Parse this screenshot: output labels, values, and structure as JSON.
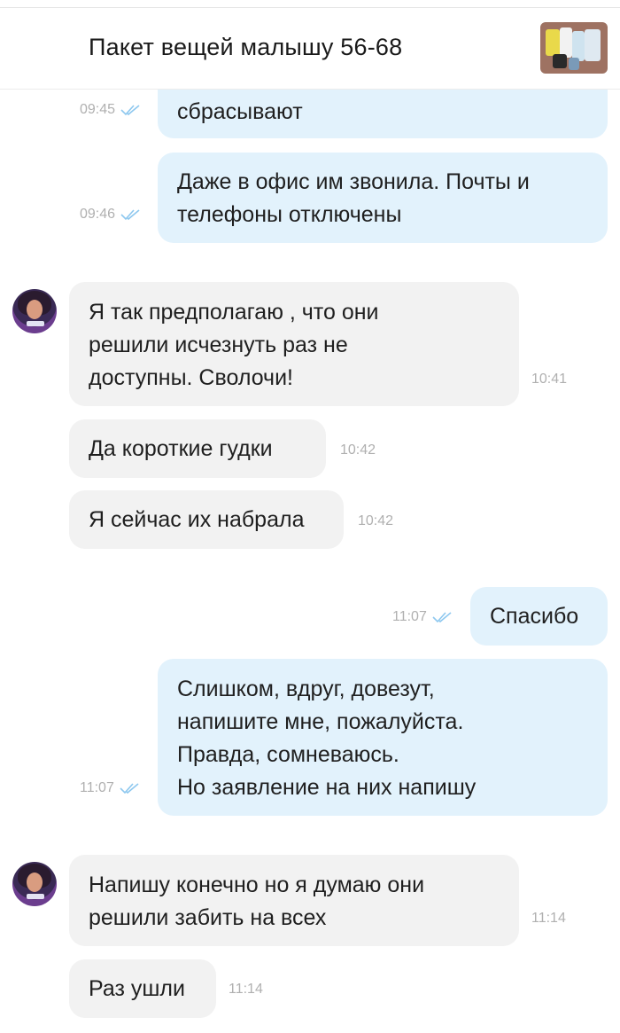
{
  "header": {
    "title": "Пакет вещей малышу 56-68",
    "thumbnail_icon": "product-photo"
  },
  "messages": [
    {
      "dir": "out",
      "text": "сбрасывают",
      "time": "09:45",
      "status": "read"
    },
    {
      "dir": "out",
      "text": "Даже в офис им звонила. Почты и\nтелефоны отключены",
      "time": "09:46",
      "status": "read"
    },
    {
      "dir": "in",
      "text": "Я так предполагаю , что они\nрешили исчезнуть раз не\nдоступны. Сволочи!",
      "time": "10:41"
    },
    {
      "dir": "in",
      "text": "Да короткие гудки",
      "time": "10:42"
    },
    {
      "dir": "in",
      "text": "Я сейчас их набрала",
      "time": "10:42"
    },
    {
      "dir": "out",
      "text": "Спасибо",
      "time": "11:07",
      "status": "read"
    },
    {
      "dir": "out",
      "text": "Слишком, вдруг, довезут,\nнапишите мне, пожалуйста.\nПравда, сомневаюсь.\nНо заявление на них напишу",
      "time": "11:07",
      "status": "read"
    },
    {
      "dir": "in",
      "text": "Напишу конечно но я думаю они\nрешили забить на всех",
      "time": "11:14"
    },
    {
      "dir": "in",
      "text": "Раз ушли",
      "time": "11:14"
    }
  ],
  "colors": {
    "outgoing_bubble": "#e2f2fc",
    "incoming_bubble": "#f2f2f2",
    "read_ticks": "#8ec8ef",
    "meta_text": "#b0b0b0"
  }
}
